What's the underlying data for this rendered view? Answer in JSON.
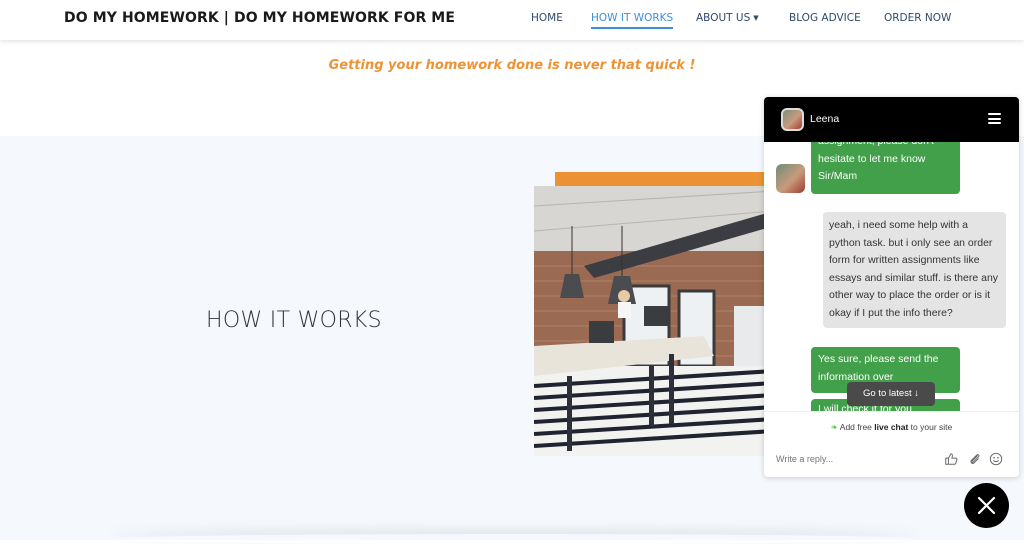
{
  "header": {
    "brand": "DO MY HOMEWORK | DO MY HOMEWORK FOR ME",
    "nav": [
      {
        "label": "HOME",
        "active": false
      },
      {
        "label": "HOW IT WORKS",
        "active": true
      },
      {
        "label": "ABOUT US",
        "active": false,
        "has_dropdown": true
      },
      {
        "label": "BLOG ADVICE",
        "active": false
      },
      {
        "label": "ORDER NOW",
        "active": false
      }
    ],
    "active_color": "#3a8fd8"
  },
  "tagline": "Getting your homework done is never that quick !",
  "section": {
    "title": "HOW IT WORKS",
    "image_alt": "open-plan office with brick walls, pendant lamps and desks",
    "accent_color": "#ec9234"
  },
  "chat": {
    "agent_name": "Leena",
    "messages": [
      {
        "from": "agent",
        "text": "assignment, please don't hesitate to let me know Sir/Mam"
      },
      {
        "from": "user",
        "text": "yeah, i need some help with a python task. but i only see an order form for written assignments like essays and similar stuff. is there any other way to place the order or is it okay if I put the info there?"
      },
      {
        "from": "agent",
        "text": "Yes sure, please send the information over"
      },
      {
        "from": "agent",
        "text": "I will check it for you"
      }
    ],
    "go_to_latest": "Go to latest",
    "powered_prefix": "Add free ",
    "powered_bold": "live chat",
    "powered_suffix": " to your site",
    "reply_placeholder": "Write a reply...",
    "agent_bubble_color": "#43a04a",
    "user_bubble_color": "#e4e4e4"
  }
}
